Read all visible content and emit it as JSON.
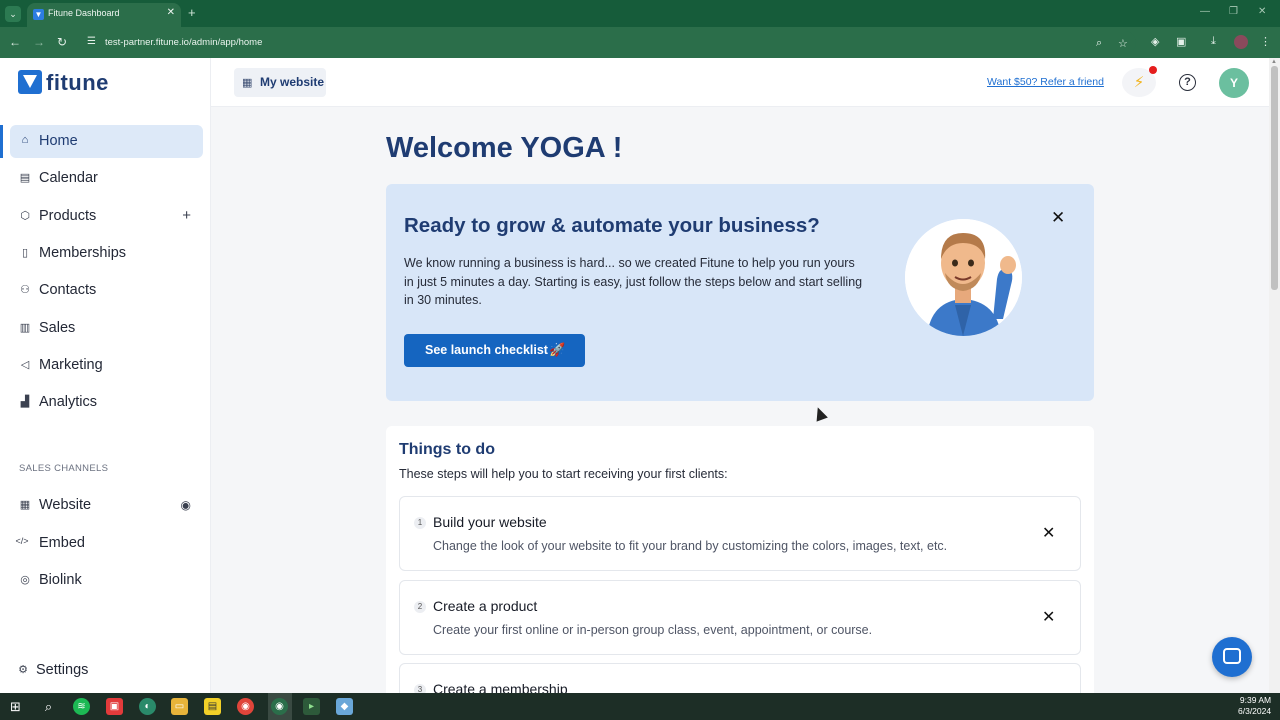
{
  "browser": {
    "tab_title": "Fitune Dashboard",
    "url": "test-partner.fitune.io/admin/app/home",
    "new_tab": "+",
    "close_tab": "✕",
    "tab_search": "⌄"
  },
  "app": {
    "logo_text": "fitune",
    "header": {
      "my_website_label": "My website",
      "refer_link": "Want $50? Refer a friend",
      "avatar_initial": "Y"
    }
  },
  "sidebar": {
    "items": [
      {
        "label": "Home",
        "icon": "home-icon",
        "glyph": "⌂",
        "active": true
      },
      {
        "label": "Calendar",
        "icon": "calendar-icon",
        "glyph": "▤"
      },
      {
        "label": "Products",
        "icon": "box-icon",
        "glyph": "⬡",
        "extra": "+"
      },
      {
        "label": "Memberships",
        "icon": "card-icon",
        "glyph": "▯"
      },
      {
        "label": "Contacts",
        "icon": "contacts-icon",
        "glyph": "⚇"
      },
      {
        "label": "Sales",
        "icon": "receipt-icon",
        "glyph": "▥"
      },
      {
        "label": "Marketing",
        "icon": "megaphone-icon",
        "glyph": "◁"
      },
      {
        "label": "Analytics",
        "icon": "chart-icon",
        "glyph": "▟"
      }
    ],
    "sales_channels_header": "SALES CHANNELS",
    "channels": [
      {
        "label": "Website",
        "icon": "globe-icon",
        "glyph": "▦",
        "extra": "◉"
      },
      {
        "label": "Embed",
        "icon": "code-icon",
        "glyph": "</>"
      },
      {
        "label": "Biolink",
        "icon": "target-icon",
        "glyph": "◎"
      }
    ],
    "settings_label": "Settings"
  },
  "main": {
    "welcome": "Welcome YOGA !",
    "hero": {
      "title": "Ready to grow & automate your business?",
      "text": "We know running a business is hard... so we created Fitune to help you run yours in just 5 minutes a day. Starting is easy, just follow the steps below and start selling in 30 minutes.",
      "button_label": "See launch checklist",
      "button_emoji": "🚀"
    },
    "todo": {
      "title": "Things to do",
      "subtitle": "These steps will help you to start receiving your first clients:",
      "steps": [
        {
          "num": "1",
          "title": "Build your website",
          "desc": "Change the look of your website to fit your brand by customizing the colors, images, text, etc."
        },
        {
          "num": "2",
          "title": "Create a product",
          "desc": "Create your first online or in-person group class, event, appointment, or course."
        },
        {
          "num": "3",
          "title": "Create a membership",
          "desc": ""
        }
      ]
    }
  },
  "taskbar": {
    "time": "9:39 AM",
    "date": "6/3/2024"
  },
  "colors": {
    "brand_blue": "#1f6fd1",
    "navy": "#1f3c72",
    "browser_green": "#2b6e4a",
    "hero_bg": "#d8e6f8"
  }
}
